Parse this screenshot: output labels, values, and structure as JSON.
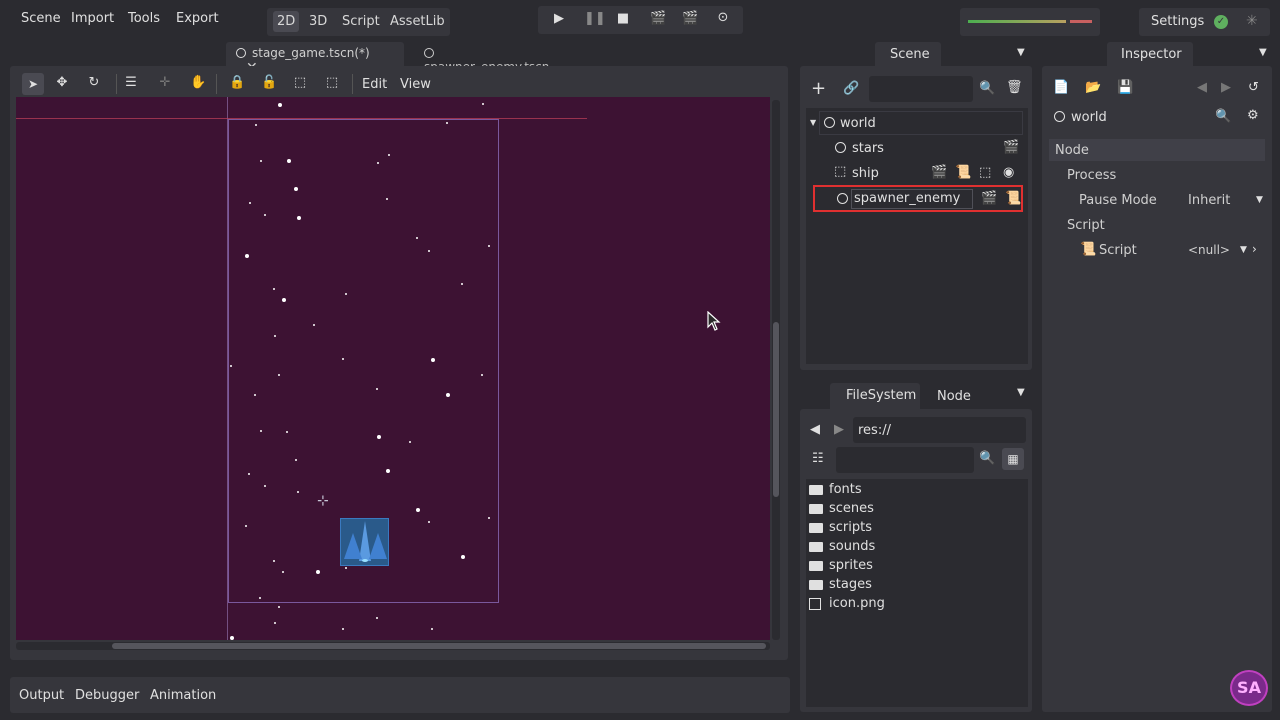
{
  "menu": {
    "scene": "Scene",
    "import": "Import",
    "tools": "Tools",
    "export": "Export"
  },
  "modes": {
    "mode_2d": "2D",
    "mode_3d": "3D",
    "script": "Script",
    "assetlib": "AssetLib"
  },
  "settings_label": "Settings",
  "tabs": {
    "tab1": "stage_game.tscn(*)",
    "tab2": "spawner_enemy.tscn"
  },
  "viewport_toolbar": {
    "edit": "Edit",
    "view": "View"
  },
  "scene_dock": {
    "title": "Scene",
    "nodes": [
      "world",
      "stars",
      "ship",
      "spawner_enemy"
    ]
  },
  "inspector": {
    "title": "Inspector",
    "object": "world",
    "section_node": "Node",
    "process": "Process",
    "pause_mode_label": "Pause Mode",
    "pause_mode_value": "Inherit",
    "script_section": "Script",
    "script_label": "Script",
    "script_value": "<null>"
  },
  "filesystem": {
    "tab_fs": "FileSystem",
    "tab_node": "Node",
    "path": "res://",
    "items": [
      "fonts",
      "scenes",
      "scripts",
      "sounds",
      "sprites",
      "stages",
      "icon.png"
    ]
  },
  "bottom_tabs": {
    "output": "Output",
    "debugger": "Debugger",
    "animation": "Animation"
  },
  "colors": {
    "canvas_bg": "#3d1233",
    "accent_red": "#e03030",
    "panel": "#36363c",
    "background": "#2b2b30"
  }
}
